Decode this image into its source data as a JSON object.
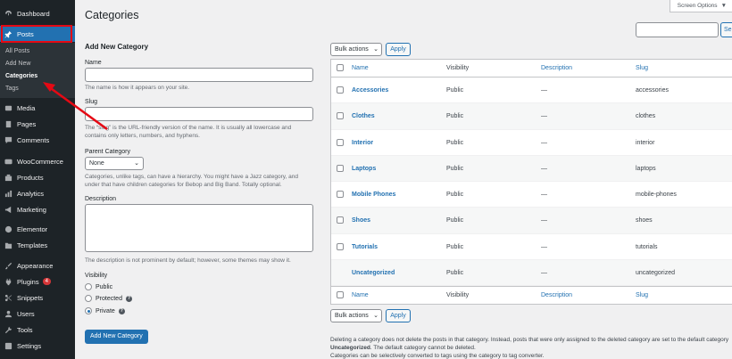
{
  "sidebar": {
    "items": [
      {
        "id": "dashboard",
        "label": "Dashboard",
        "icon": "dashboard-icon"
      },
      {
        "id": "posts",
        "label": "Posts",
        "icon": "pin-icon"
      },
      {
        "id": "media",
        "label": "Media",
        "icon": "media-icon"
      },
      {
        "id": "pages",
        "label": "Pages",
        "icon": "pages-icon"
      },
      {
        "id": "comments",
        "label": "Comments",
        "icon": "comments-icon"
      },
      {
        "id": "woocommerce",
        "label": "WooCommerce",
        "icon": "woocommerce-icon"
      },
      {
        "id": "products",
        "label": "Products",
        "icon": "products-icon"
      },
      {
        "id": "analytics",
        "label": "Analytics",
        "icon": "analytics-icon"
      },
      {
        "id": "marketing",
        "label": "Marketing",
        "icon": "megaphone-icon"
      },
      {
        "id": "elementor",
        "label": "Elementor",
        "icon": "elementor-icon"
      },
      {
        "id": "templates",
        "label": "Templates",
        "icon": "folder-icon"
      },
      {
        "id": "appearance",
        "label": "Appearance",
        "icon": "brush-icon"
      },
      {
        "id": "plugins",
        "label": "Plugins",
        "icon": "plugin-icon",
        "badge": "4"
      },
      {
        "id": "snippets",
        "label": "Snippets",
        "icon": "scissors-icon"
      },
      {
        "id": "users",
        "label": "Users",
        "icon": "users-icon"
      },
      {
        "id": "tools",
        "label": "Tools",
        "icon": "wrench-icon"
      },
      {
        "id": "settings",
        "label": "Settings",
        "icon": "settings-icon"
      }
    ],
    "submenu": [
      "All Posts",
      "Add New",
      "Categories",
      "Tags"
    ]
  },
  "header": {
    "title": "Categories",
    "screen_options": "Screen Options",
    "search_button": "Se"
  },
  "form": {
    "heading": "Add New Category",
    "name_label": "Name",
    "name_desc": "The name is how it appears on your site.",
    "slug_label": "Slug",
    "slug_desc_1": "The “slug” is the URL-friendly version of the name. It is usually all lowercase and",
    "slug_desc_2": "contains only letters, numbers, and hyphens.",
    "parent_label": "Parent Category",
    "parent_value": "None",
    "parent_desc_1": "Categories, unlike tags, can have a hierarchy. You might have a Jazz category, and",
    "parent_desc_2": "under that have children categories for Bebop and Big Band. Totally optional.",
    "description_label": "Description",
    "description_desc": "The description is not prominent by default; however, some themes may show it.",
    "visibility_label": "Visibility",
    "visibility_options": [
      "Public",
      "Protected",
      "Private"
    ],
    "submit": "Add New Category"
  },
  "table": {
    "bulk_actions": "Bulk actions",
    "apply": "Apply",
    "columns": [
      "Name",
      "Visibility",
      "Description",
      "Slug"
    ],
    "rows": [
      {
        "name": "Accessories",
        "visibility": "Public",
        "description": "—",
        "slug": "accessories"
      },
      {
        "name": "Clothes",
        "visibility": "Public",
        "description": "—",
        "slug": "clothes"
      },
      {
        "name": "Interior",
        "visibility": "Public",
        "description": "—",
        "slug": "interior"
      },
      {
        "name": "Laptops",
        "visibility": "Public",
        "description": "—",
        "slug": "laptops"
      },
      {
        "name": "Mobile Phones",
        "visibility": "Public",
        "description": "—",
        "slug": "mobile-phones"
      },
      {
        "name": "Shoes",
        "visibility": "Public",
        "description": "—",
        "slug": "shoes"
      },
      {
        "name": "Tutorials",
        "visibility": "Public",
        "description": "—",
        "slug": "tutorials"
      },
      {
        "name": "Uncategorized",
        "visibility": "Public",
        "description": "—",
        "slug": "uncategorized"
      }
    ]
  },
  "footer": {
    "note_1": "Deleting a category does not delete the posts in that category. Instead, posts that were only assigned to the deleted category are set to the default category",
    "note_2_bold": "Uncategorized",
    "note_2_rest": ". The default category cannot be deleted.",
    "note_3": "Categories can be selectively converted to tags using the category to tag converter."
  },
  "colors": {
    "accent": "#2271b1",
    "sidebar_bg": "#1d2327",
    "highlight": "#e50914"
  }
}
